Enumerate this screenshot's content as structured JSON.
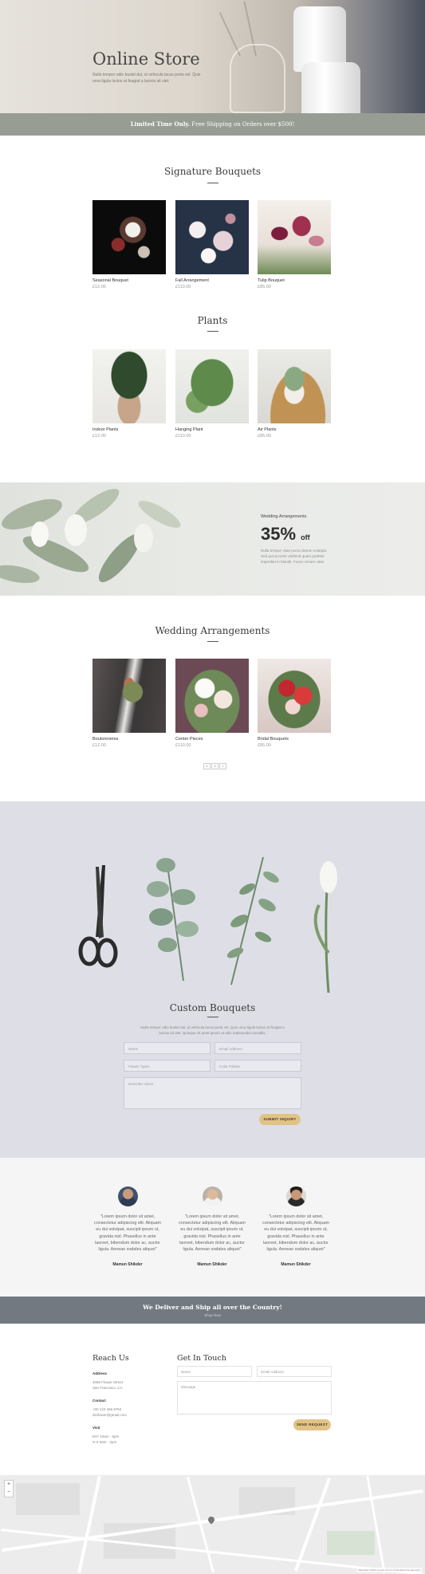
{
  "hero": {
    "title": "Online Store",
    "text": "Nulla tempor odio buslet dui, ut vehicula lacus porta vel. Quis urna ligula luctus at feugiat a lacinia sit ulet."
  },
  "promo": {
    "bold": "Limited Time Only.",
    "text": " Free Shipping on Orders over $500!"
  },
  "signature": {
    "title": "Signature Bouquets",
    "items": [
      {
        "name": "Seasonal Bouquet",
        "price": "£12.00"
      },
      {
        "name": "Fall Arrangement",
        "price": "£110.00"
      },
      {
        "name": "Tulip Bouquet",
        "price": "£85.00"
      }
    ]
  },
  "plants": {
    "title": "Plants",
    "items": [
      {
        "name": "Indoor Plants",
        "price": "£12.00"
      },
      {
        "name": "Hanging Plant",
        "price": "£110.00"
      },
      {
        "name": "Air Plants",
        "price": "£85.00"
      }
    ]
  },
  "discount": {
    "subtitle": "Wedding Arrangements",
    "value": "35%",
    "suffix": "off",
    "text": "Nulla tempor vitae purus dictum volutpat. Sed purus tortor eleifend quam porttitor imperdiet in blandit. Fusce ornare vitae."
  },
  "wedding": {
    "title": "Wedding Arrangements",
    "items": [
      {
        "name": "Boutonnieres",
        "price": "£12.00"
      },
      {
        "name": "Center Pieces",
        "price": "£110.00"
      },
      {
        "name": "Bridal Bouquets",
        "price": "£85.00"
      }
    ],
    "pager": [
      "1",
      "2",
      "»"
    ]
  },
  "custom": {
    "title": "Custom Bouquets",
    "text": "Nulla tempor odio buslet dui, ut vehicula lacus porta vel. Quis urna ligula luctus at feugiat a lacinia sit ulet. Quisque sit amet ipsum ut odio malesuada convallis.",
    "fields": {
      "name": "Name",
      "email": "Email Address",
      "flower": "Flower Types",
      "color": "Color Palette",
      "describe": "Describe Vision"
    },
    "submit": "SUBMIT INQUIRY"
  },
  "testimonials": [
    {
      "quote": "\"Lorem ipsum dolor sit amet, consectetur adipiscing elit. Aliquam eu dui volutpat, suscipit ipsum ut, gravida nisl. Phasellus in ante laoreet, bibendum dolor ac, auctor ligula. Aenean sodales aliquet\"",
      "name": "Mamun Shikder"
    },
    {
      "quote": "\"Lorem ipsum dolor sit amet, consectetur adipiscing elit. Aliquam eu dui volutpat, suscipit ipsum ut, gravida nisl. Phasellus in ante laoreet, bibendum dolor ac, auctor ligula. Aenean sodales aliquet\"",
      "name": "Mamun Shikder"
    },
    {
      "quote": "\"Lorem ipsum dolor sit amet, consectetur adipiscing elit. Aliquam eu dui volutpat, suscipit ipsum ut, gravida nisl. Phasellus in ante laoreet, bibendum dolor ac, auctor ligula. Aenean sodales aliquet\"",
      "name": "Mamun Shikder"
    }
  ],
  "ship": {
    "title": "We Deliver and Ship all over the Country!",
    "link": "Shop Now"
  },
  "contact": {
    "reach_title": "Reach Us",
    "address_label": "Address",
    "address": [
      "4066 Flower Street",
      "San Francisco, CA"
    ],
    "contact_label": "Contact",
    "contact": [
      "+00 123 456 8754",
      "divifower@gmail.com"
    ],
    "visit_label": "Visit",
    "visit": [
      "M-F 10am - 6pm",
      "S-S 9am - 2pm"
    ],
    "form_title": "Get In Touch",
    "name": "Name",
    "email": "Email Address",
    "message": "Message",
    "send": "SEND REQUEST"
  },
  "map": {
    "zoom_in": "+",
    "zoom_out": "−",
    "attribution": "Map data ©2023 Google  Terms of Use  Report a map error"
  },
  "colors": {
    "promo_bg": "#979d93",
    "gold_button": "#e2c387",
    "ship_bg": "#737981",
    "custom_bg": "#dedfe6"
  }
}
